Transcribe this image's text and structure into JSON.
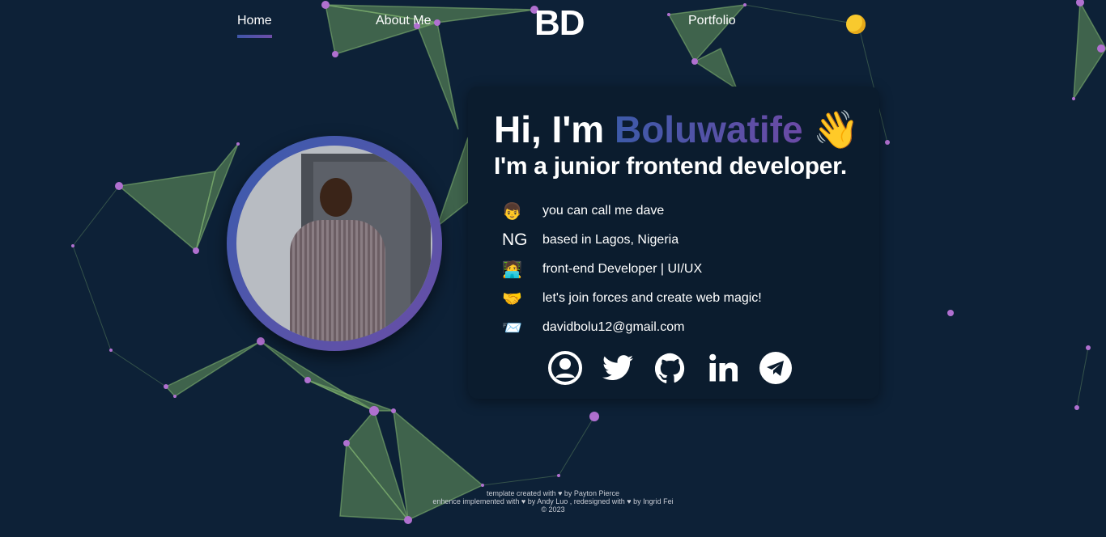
{
  "nav": {
    "home": "Home",
    "about": "About Me",
    "logo": "BD",
    "portfolio": "Portfolio",
    "theme_icon": "moon-icon"
  },
  "hero": {
    "greeting": "Hi, I'm ",
    "name": "Boluwatife",
    "wave": "👋",
    "subtitle": "I'm a junior frontend developer.",
    "items": [
      {
        "icon": "👦",
        "text": "you can call me dave"
      },
      {
        "icon": "NG",
        "text": "based in Lagos, Nigeria"
      },
      {
        "icon": "🧑‍💻",
        "text": "front-end Developer | UI/UX"
      },
      {
        "icon": "🤝",
        "text": "let's join forces and create web magic!"
      },
      {
        "icon": "📨",
        "text": "davidbolu12@gmail.com"
      }
    ],
    "social": [
      "profile-icon",
      "twitter-icon",
      "github-icon",
      "linkedin-icon",
      "telegram-icon"
    ]
  },
  "footer": {
    "line1": "template created with ♥ by Payton Pierce",
    "line2": "enhence implemented with ♥ by Andy Luo , redesigned with ♥ by Ingrid Fei",
    "line3": "© 2023"
  },
  "colors": {
    "background": "#0d2137",
    "card": "#0b1c2e",
    "accent_start": "#3d5aa8",
    "accent_end": "#6b4aa6",
    "node": "#b070d0",
    "mesh": "#6a9a5e"
  }
}
